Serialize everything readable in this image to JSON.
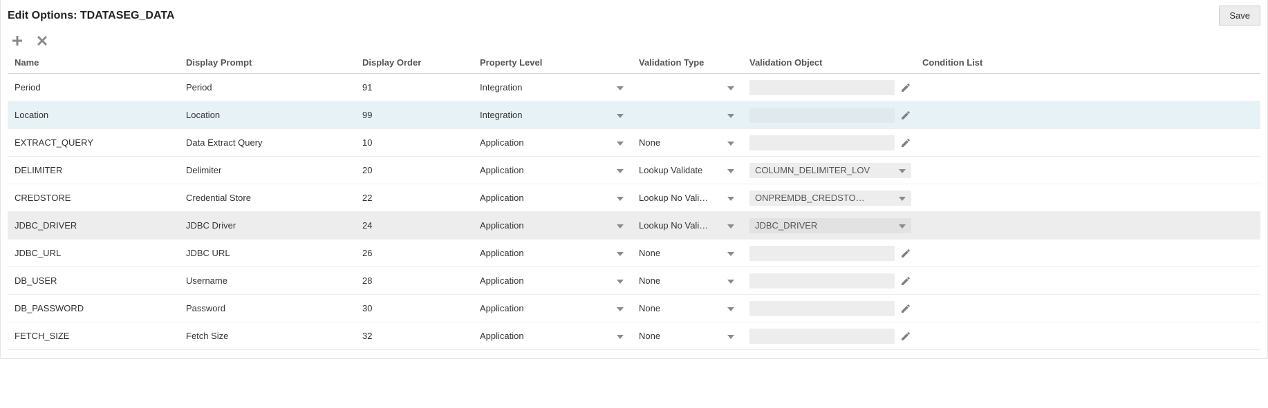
{
  "header": {
    "title": "Edit Options: TDATASEG_DATA",
    "save_label": "Save"
  },
  "columns": {
    "name": "Name",
    "display_prompt": "Display Prompt",
    "display_order": "Display Order",
    "property_level": "Property Level",
    "validation_type": "Validation Type",
    "validation_object": "Validation Object",
    "condition_list": "Condition List"
  },
  "rows": [
    {
      "name": "Period",
      "display_prompt": "Period",
      "display_order": "91",
      "property_level": "Integration",
      "validation_type": "",
      "validation_object": "",
      "vobj_is_dropdown": false,
      "state": ""
    },
    {
      "name": "Location",
      "display_prompt": "Location",
      "display_order": "99",
      "property_level": "Integration",
      "validation_type": "",
      "validation_object": "",
      "vobj_is_dropdown": false,
      "state": "selected"
    },
    {
      "name": "EXTRACT_QUERY",
      "display_prompt": "Data Extract Query",
      "display_order": "10",
      "property_level": "Application",
      "validation_type": "None",
      "validation_object": "",
      "vobj_is_dropdown": false,
      "state": ""
    },
    {
      "name": "DELIMITER",
      "display_prompt": "Delimiter",
      "display_order": "20",
      "property_level": "Application",
      "validation_type": "Lookup Validate",
      "validation_object": "COLUMN_DELIMITER_LOV",
      "vobj_is_dropdown": true,
      "state": ""
    },
    {
      "name": "CREDSTORE",
      "display_prompt": "Credential Store",
      "display_order": "22",
      "property_level": "Application",
      "validation_type": "Lookup No Vali…",
      "validation_object": "ONPREMDB_CREDSTO…",
      "vobj_is_dropdown": true,
      "state": ""
    },
    {
      "name": "JDBC_DRIVER",
      "display_prompt": "JDBC Driver",
      "display_order": "24",
      "property_level": "Application",
      "validation_type": "Lookup No Vali…",
      "validation_object": "JDBC_DRIVER",
      "vobj_is_dropdown": true,
      "state": "active"
    },
    {
      "name": "JDBC_URL",
      "display_prompt": "JDBC URL",
      "display_order": "26",
      "property_level": "Application",
      "validation_type": "None",
      "validation_object": "",
      "vobj_is_dropdown": false,
      "state": ""
    },
    {
      "name": "DB_USER",
      "display_prompt": "Username",
      "display_order": "28",
      "property_level": "Application",
      "validation_type": "None",
      "validation_object": "",
      "vobj_is_dropdown": false,
      "state": ""
    },
    {
      "name": "DB_PASSWORD",
      "display_prompt": "Password",
      "display_order": "30",
      "property_level": "Application",
      "validation_type": "None",
      "validation_object": "",
      "vobj_is_dropdown": false,
      "state": ""
    },
    {
      "name": "FETCH_SIZE",
      "display_prompt": "Fetch Size",
      "display_order": "32",
      "property_level": "Application",
      "validation_type": "None",
      "validation_object": "",
      "vobj_is_dropdown": false,
      "state": ""
    }
  ]
}
